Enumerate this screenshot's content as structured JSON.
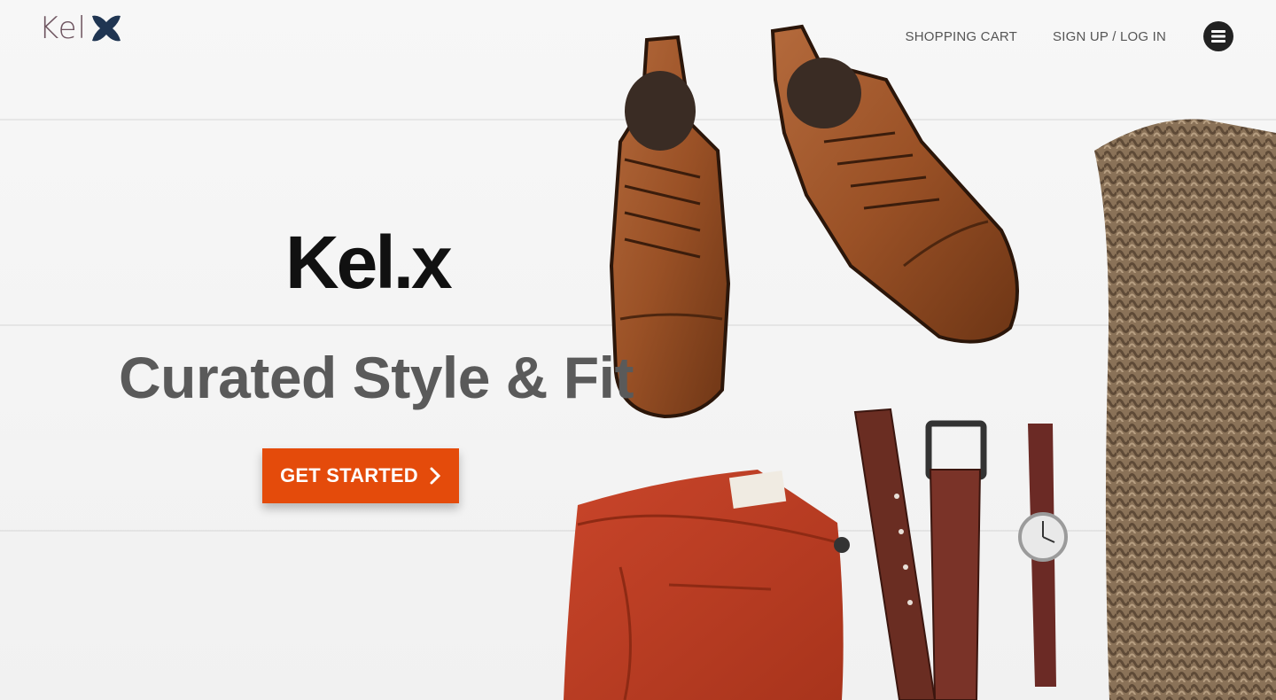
{
  "header": {
    "logo_text": "Kel",
    "nav": {
      "cart": "SHOPPING CART",
      "signup": "SIGN UP / LOG IN"
    },
    "menu_icon": "hamburger-icon"
  },
  "hero": {
    "brand": "Kel.x",
    "tagline": "Curated Style & Fit",
    "cta_label": "GET STARTED",
    "cta_icon": "chevron-right-icon"
  },
  "colors": {
    "accent": "#e44b0b",
    "logo_x": "#1f3552",
    "logo_text": "#6e5560"
  }
}
